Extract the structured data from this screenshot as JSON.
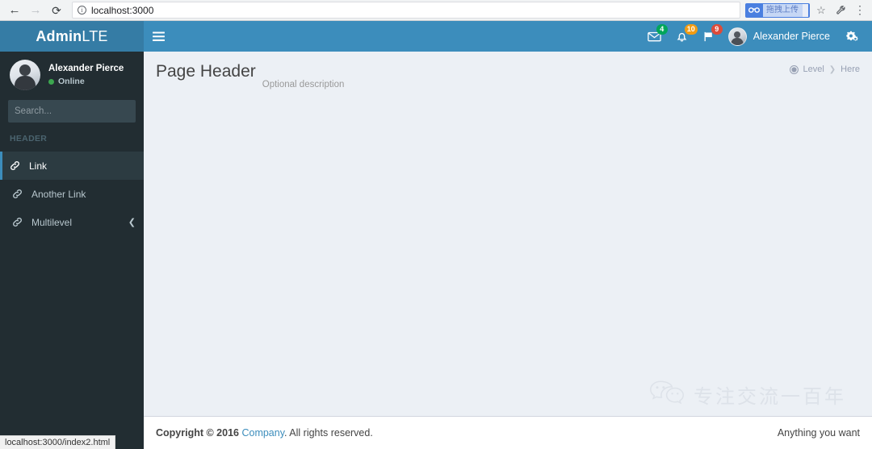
{
  "browser": {
    "back_icon": "arrow-left-icon",
    "forward_icon": "arrow-right-icon",
    "reload_icon": "reload-icon",
    "site_info_icon": "info-circle-icon",
    "url_host": "localhost",
    "url_rest": ":3000",
    "url_full": "localhost:3000",
    "extension": {
      "icon": "cloud-upload-icon",
      "label": "拖拽上传",
      "accent": "#4a7fe0"
    },
    "bookmark_icon": "star-icon",
    "tools_icon": "wrench-icon",
    "menu_icon": "three-dots-vertical-icon",
    "status_text": "localhost:3000/index2.html"
  },
  "logo": {
    "bold": "Admin",
    "light": "LTE",
    "bg": "#357ca5"
  },
  "navbar": {
    "bg": "#3c8dbc",
    "toggle_icon": "hamburger-menu-icon",
    "items": [
      {
        "icon": "envelope-icon",
        "badge": "4",
        "badge_color": "#00a65a",
        "badge_class": "green"
      },
      {
        "icon": "bell-icon",
        "badge": "10",
        "badge_color": "#f39c12",
        "badge_class": "yellow"
      },
      {
        "icon": "flag-icon",
        "badge": "9",
        "badge_color": "#dd4b39",
        "badge_class": "red"
      }
    ],
    "user": {
      "avatar_icon": "user-avatar",
      "name": "Alexander Pierce"
    },
    "control_sidebar_icon": "cogs-icon"
  },
  "sidebar": {
    "bg": "#222d32",
    "user_panel": {
      "avatar_icon": "user-avatar",
      "name": "Alexander Pierce",
      "status": "Online",
      "status_color": "#3ca64f"
    },
    "search": {
      "placeholder": "Search...",
      "value": "",
      "button_icon": "search-icon"
    },
    "menu_header": "HEADER",
    "items": [
      {
        "icon": "link-icon",
        "label": "Link",
        "active": true,
        "arrow": ""
      },
      {
        "icon": "link-icon",
        "label": "Another Link",
        "active": false,
        "arrow": ""
      },
      {
        "icon": "link-icon",
        "label": "Multilevel",
        "active": false,
        "arrow": "❮"
      }
    ]
  },
  "content": {
    "title": "Page Header",
    "description": "Optional description",
    "breadcrumb": {
      "icon": "dashboard-icon",
      "level": "Level",
      "separator": "❯",
      "here": "Here"
    },
    "background": "#ecf0f5",
    "watermark": {
      "icon": "wechat-icon",
      "text": "专注交流一百年"
    }
  },
  "footer": {
    "copyright_prefix": "Copyright © 2016 ",
    "company": "Company",
    "copyright_suffix": ". All rights reserved.",
    "right_text": "Anything you want",
    "link_color": "#3c8dbc"
  }
}
